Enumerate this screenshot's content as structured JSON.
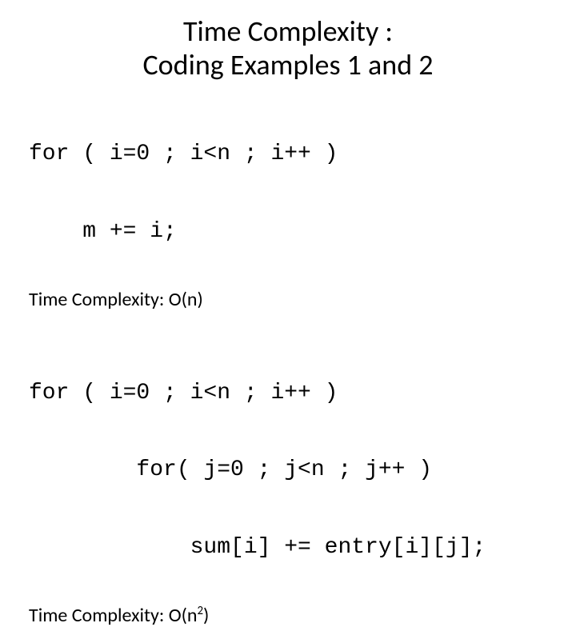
{
  "title_line1": "Time Complexity :",
  "title_line2": "Coding Examples 1 and 2",
  "example1": {
    "code_line1": "for ( i=0 ; i<n ; i++ )",
    "code_line2": "    m += i;",
    "complexity_prefix": "Time Complexity: O(n)"
  },
  "example2": {
    "code_line1": "for ( i=0 ; i<n ; i++ )",
    "code_line2": "        for( j=0 ; j<n ; j++ )",
    "code_line3": "            sum[i] += entry[i][j];",
    "complexity_prefix": "Time Complexity: O(n",
    "complexity_exp": "2",
    "complexity_suffix": ")"
  }
}
